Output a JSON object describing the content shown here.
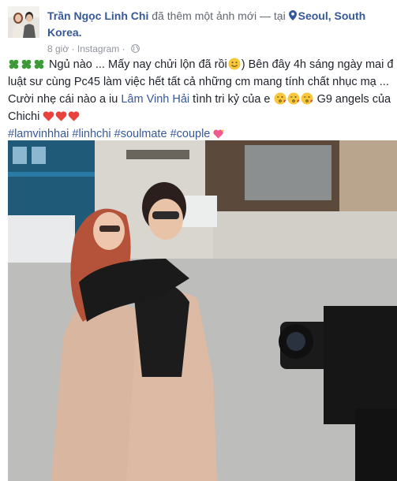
{
  "post": {
    "author": "Trần Ngọc Linh Chi",
    "action": "đã thêm một ảnh mới — tại",
    "location": "Seoul, South Korea.",
    "time": "8 giờ",
    "separator": "·",
    "audience": "Instagram",
    "dot": "·",
    "icons": {
      "avatar": "profile-photo",
      "location": "location-pin-icon",
      "privacy": "globe-icon",
      "clover": "four-leaf-clover-icon",
      "smile": "smiling-face-icon",
      "kiss": "face-blowing-kiss-icon",
      "heart": "red-heart-icon",
      "sparkle_heart": "sparkling-heart-icon"
    },
    "text": {
      "line1": "Ngủ nào ... Mấy nay chửi lộn đã rồi",
      "line1_end": "Bên đây 4h sáng ngày mai để",
      "line2": "luật sư cùng Pc45 làm việc hết tất cả những cm mang tính chất nhục mạ ...",
      "line3_start": "Cười nhẹ cái nào a iu",
      "mention": "Lâm Vinh Hải",
      "line3_end": "tình tri kỷ của e",
      "line3_tail": "G9 angels của",
      "line4": "Chichi",
      "hashtags": [
        "#lamvinhhai",
        "#linhchi",
        "#soulmate",
        "#couple"
      ]
    }
  },
  "colors": {
    "link": "#365899",
    "text": "#1d2129",
    "meta": "#616770",
    "muted": "#90949c",
    "heart": "#e8413e"
  }
}
